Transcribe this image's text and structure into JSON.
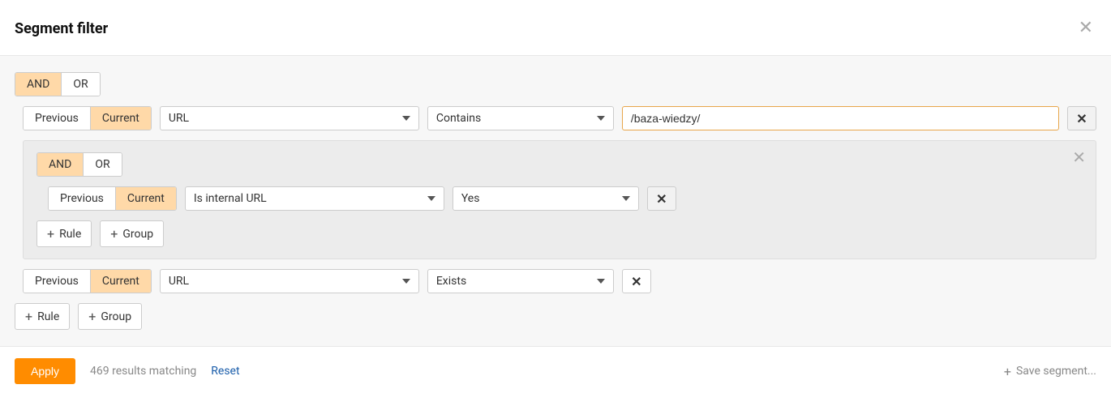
{
  "header": {
    "title": "Segment filter"
  },
  "logic": {
    "and": "AND",
    "or": "OR"
  },
  "toggle": {
    "previous": "Previous",
    "current": "Current"
  },
  "rule1": {
    "field": "URL",
    "operator": "Contains",
    "value": "/baza-wiedzy/"
  },
  "nested": {
    "rule": {
      "field": "Is internal URL",
      "operator": "Yes"
    }
  },
  "rule3": {
    "field": "URL",
    "operator": "Exists"
  },
  "buttons": {
    "rule": "Rule",
    "group": "Group"
  },
  "footer": {
    "apply": "Apply",
    "results": "469 results matching",
    "reset": "Reset",
    "save": "Save segment..."
  }
}
